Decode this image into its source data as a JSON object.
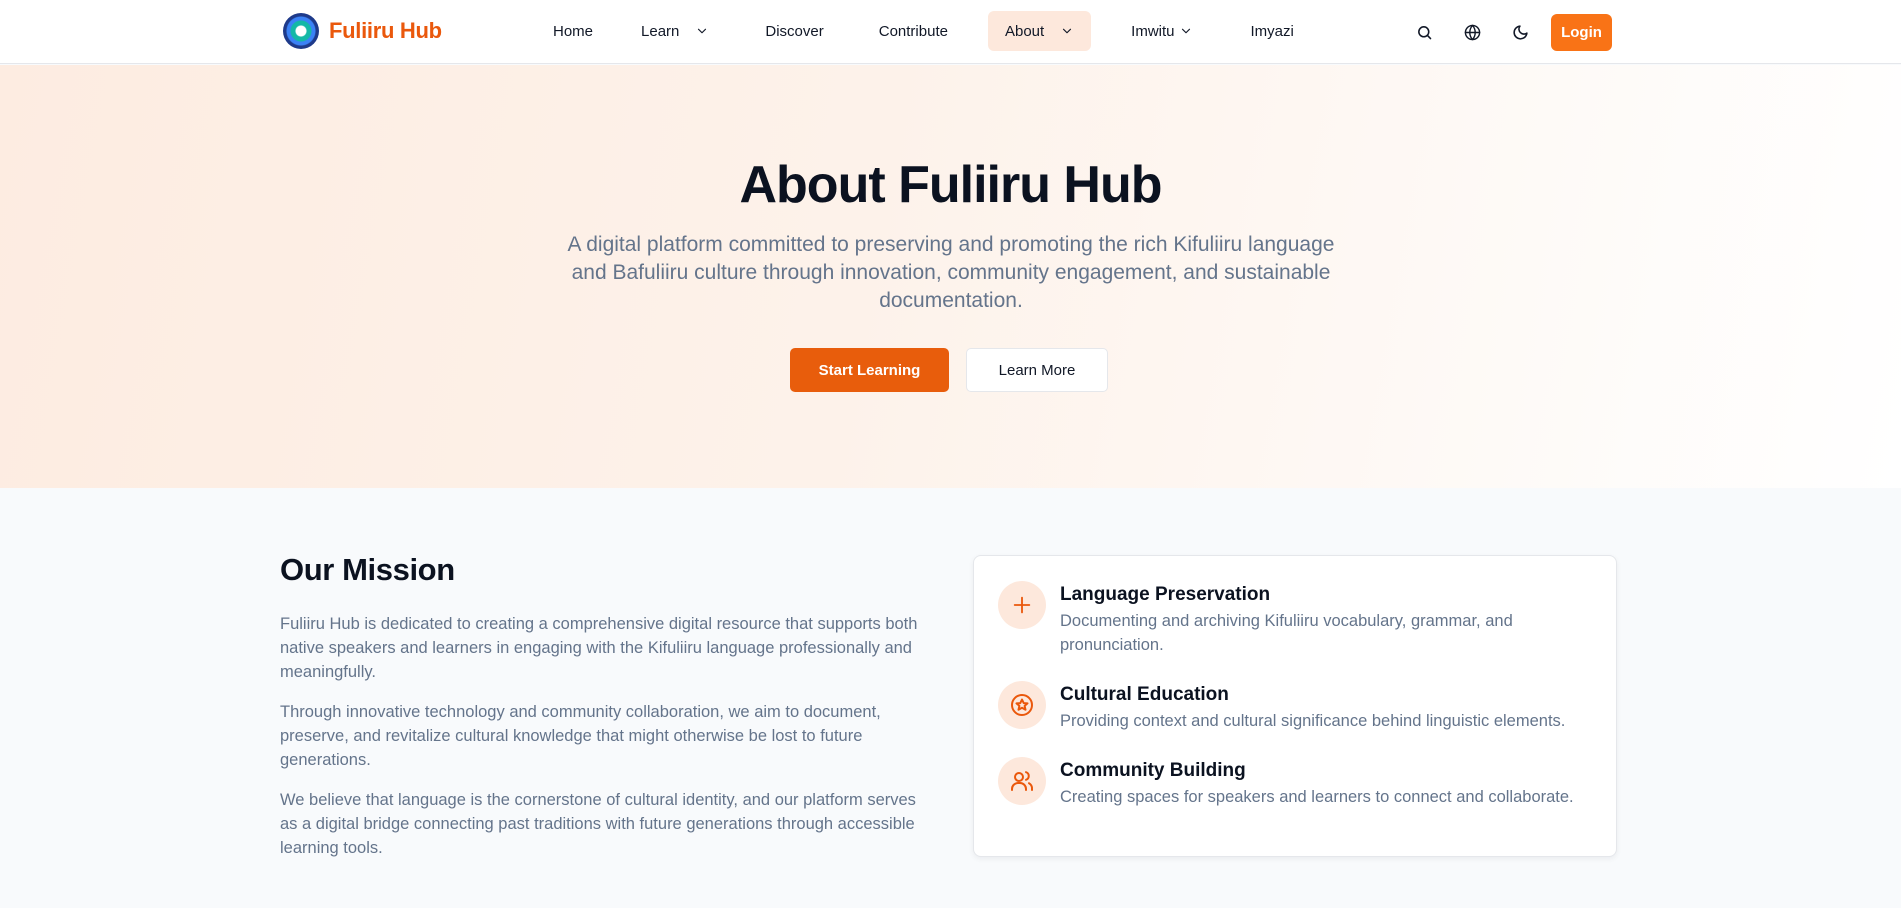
{
  "brand": {
    "name": "Fuliiru Hub"
  },
  "nav": {
    "items": [
      {
        "label": "Home"
      },
      {
        "label": "Learn"
      },
      {
        "label": "Discover"
      },
      {
        "label": "Contribute"
      },
      {
        "label": "About"
      },
      {
        "label": "Imwitu"
      },
      {
        "label": "Imyazi"
      }
    ]
  },
  "header": {
    "login_label": "Login"
  },
  "hero": {
    "title": "About Fuliiru Hub",
    "subtitle": "A digital platform committed to preserving and promoting the rich Kifuliiru language and Bafuliiru culture through innovation, community engagement, and sustainable documentation.",
    "primary_cta": "Start Learning",
    "secondary_cta": "Learn More"
  },
  "mission": {
    "title": "Our Mission",
    "paragraphs": [
      "Fuliiru Hub is dedicated to creating a comprehensive digital resource that supports both native speakers and learners in engaging with the Kifuliiru language professionally and meaningfully.",
      "Through innovative technology and community collaboration, we aim to document, preserve, and revitalize cultural knowledge that might otherwise be lost to future generations.",
      "We believe that language is the cornerstone of cultural identity, and our platform serves as a digital bridge connecting past traditions with future generations through accessible learning tools."
    ],
    "features": [
      {
        "title": "Language Preservation",
        "description": "Documenting and archiving Kifuliiru vocabulary, grammar, and pronunciation.",
        "icon": "plus-icon"
      },
      {
        "title": "Cultural Education",
        "description": "Providing context and cultural significance behind linguistic elements.",
        "icon": "star-badge-icon"
      },
      {
        "title": "Community Building",
        "description": "Creating spaces for speakers and learners to connect and collaborate.",
        "icon": "users-icon"
      }
    ]
  },
  "colors": {
    "accent": "#ea580c",
    "accent_soft": "#fde8dc",
    "muted_text": "#64748b"
  }
}
